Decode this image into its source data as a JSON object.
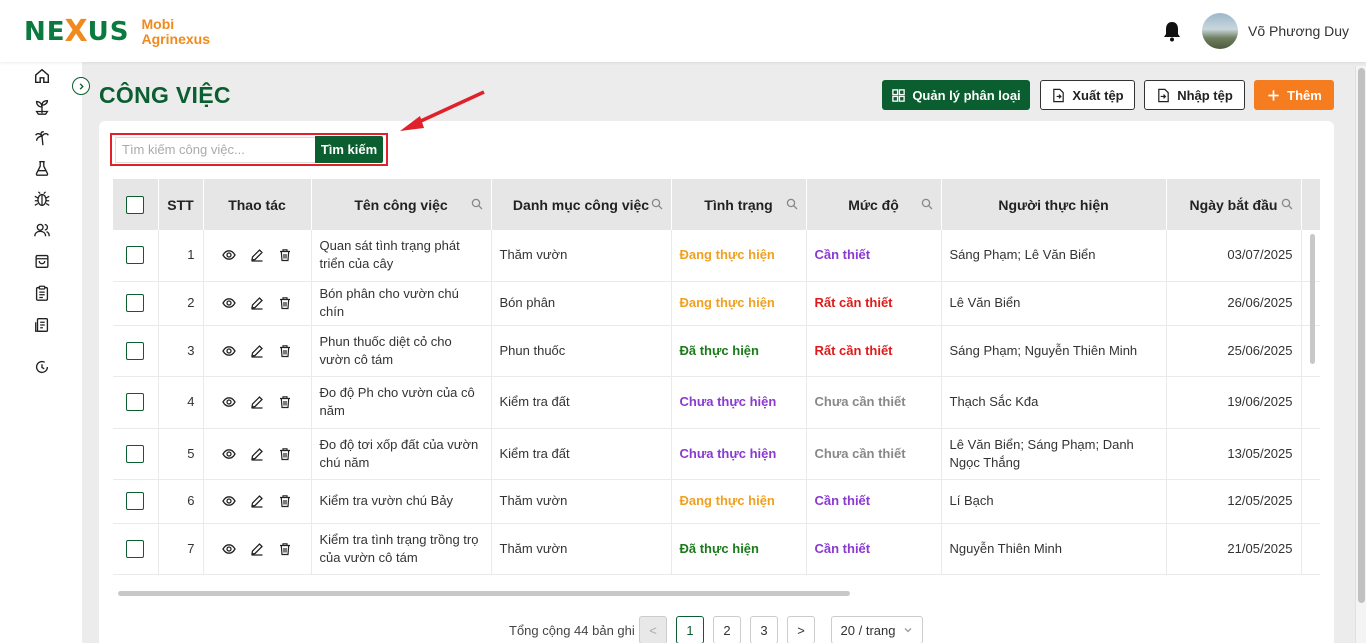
{
  "brand": {
    "mark_left": "NE",
    "mark_x": "X",
    "mark_right": "US",
    "line1": "Mobi",
    "line2": "Agrinexus"
  },
  "user": {
    "name": "Võ Phương Duy"
  },
  "page": {
    "title": "CÔNG VIỆC"
  },
  "toolbar": {
    "manage_label": "Quản lý phân loại",
    "export_label": "Xuất tệp",
    "import_label": "Nhập tệp",
    "add_label": "Thêm"
  },
  "search": {
    "placeholder": "Tìm kiếm công việc...",
    "button_label": "Tìm kiếm"
  },
  "table": {
    "headers": {
      "stt": "STT",
      "actions": "Thao tác",
      "name": "Tên công việc",
      "category": "Danh mục công việc",
      "status": "Tình trạng",
      "level": "Mức độ",
      "assignee": "Người thực hiện",
      "start": "Ngày bắt đầu"
    },
    "rows": [
      {
        "stt": "1",
        "name": "Quan sát tình trạng phát triển của cây",
        "category": "Thăm vườn",
        "status": "Đang thực hiện",
        "level": "Cần thiết",
        "assignee": "Sáng Phạm; Lê  Văn Biển",
        "start": "03/07/2025"
      },
      {
        "stt": "2",
        "name": "Bón phân cho vườn chú chín",
        "category": "Bón phân",
        "status": "Đang thực hiện",
        "level": "Rất cần thiết",
        "assignee": "Lê  Văn Biển",
        "start": "26/06/2025"
      },
      {
        "stt": "3",
        "name": "Phun thuốc diệt cỏ cho vườn cô tám",
        "category": "Phun thuốc",
        "status": "Đã thực hiện",
        "level": "Rất cần thiết",
        "assignee": "Sáng Phạm; Nguyễn  Thiên Minh",
        "start": "25/06/2025"
      },
      {
        "stt": "4",
        "name": "Đo độ Ph cho vườn của cô năm",
        "category": "Kiểm tra đất",
        "status": "Chưa thực hiện",
        "level": "Chưa cần thiết",
        "assignee": "Thạch Sắc Kđa",
        "start": "19/06/2025"
      },
      {
        "stt": "5",
        "name": "Đo độ tơi xốp đất của vườn chú năm",
        "category": "Kiểm tra đất",
        "status": "Chưa thực hiện",
        "level": "Chưa cần thiết",
        "assignee": "Lê  Văn Biển; Sáng Phạm; Danh  Ngọc Thắng",
        "start": "13/05/2025"
      },
      {
        "stt": "6",
        "name": "Kiểm tra vườn chú Bảy",
        "category": "Thăm vườn",
        "status": "Đang thực hiện",
        "level": "Cần thiết",
        "assignee": "Lí  Bạch",
        "start": "12/05/2025"
      },
      {
        "stt": "7",
        "name": "Kiểm tra tình trạng trồng trọ của vườn cô tám",
        "category": "Thăm vườn",
        "status": "Đã thực hiện",
        "level": "Cần thiết",
        "assignee": "Nguyễn  Thiên Minh",
        "start": "21/05/2025"
      }
    ]
  },
  "pagination": {
    "total_label": "Tổng cộng 44 bản ghi",
    "pages": [
      "1",
      "2",
      "3"
    ],
    "prev": "<",
    "next": ">",
    "page_size": "20 / trang"
  },
  "colors": {
    "brand_green": "#0b5e2f",
    "accent_orange": "#f57c1f",
    "highlight_red": "#e0202a"
  }
}
